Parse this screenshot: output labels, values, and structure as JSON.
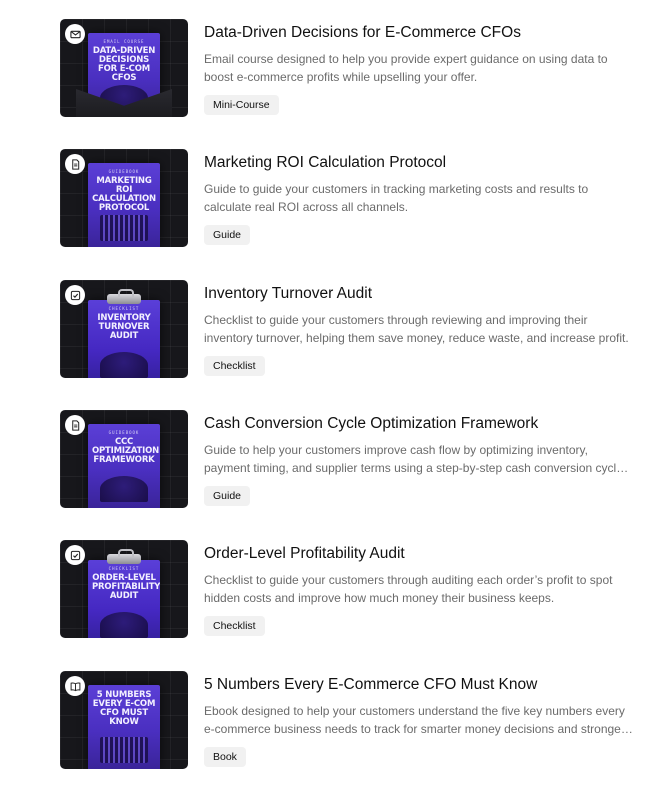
{
  "items": [
    {
      "icon": "mail-icon",
      "cover_kicker": "EMAIL COURSE",
      "cover_title": "DATA-DRIVEN DECISIONS FOR E-COM CFOS",
      "title": "Data-Driven Decisions for E-Commerce CFOs",
      "description": "Email course designed to help you provide expert guidance on using data to boost e-commerce profits while upselling your offer.",
      "tag": "Mini-Course"
    },
    {
      "icon": "document-icon",
      "cover_kicker": "GUIDEBOOK",
      "cover_title": "MARKETING ROI CALCULATION PROTOCOL",
      "title": "Marketing ROI Calculation Protocol",
      "description": "Guide to guide your customers in tracking marketing costs and results to calculate real ROI across all channels.",
      "tag": "Guide"
    },
    {
      "icon": "checklist-icon",
      "cover_kicker": "CHECKLIST",
      "cover_title": "INVENTORY TURNOVER AUDIT",
      "title": "Inventory Turnover Audit",
      "description": "Checklist to guide your customers through reviewing and improving their inventory turnover, helping them save money, reduce waste, and increase profit.",
      "tag": "Checklist"
    },
    {
      "icon": "document-icon",
      "cover_kicker": "GUIDEBOOK",
      "cover_title": "CCC OPTIMIZATION FRAMEWORK",
      "title": "Cash Conversion Cycle Optimization Framework",
      "description": "Guide to help your customers improve cash flow by optimizing inventory, payment timing, and supplier terms using a step-by-step cash conversion cycle framework.",
      "tag": "Guide"
    },
    {
      "icon": "checklist-icon",
      "cover_kicker": "CHECKLIST",
      "cover_title": "ORDER-LEVEL PROFITABILITY AUDIT",
      "title": "Order-Level Profitability Audit",
      "description": "Checklist to guide your customers through auditing each order’s profit to spot hidden costs and improve how much money their business keeps.",
      "tag": "Checklist"
    },
    {
      "icon": "book-icon",
      "cover_kicker": "",
      "cover_title": "5 NUMBERS EVERY E-COM CFO MUST KNOW",
      "title": "5 Numbers Every E-Commerce CFO Must Know",
      "description": "Ebook designed to help your customers understand the five key numbers every e-commerce business needs to track for smarter money decisions and stronger growth.",
      "tag": "Book"
    }
  ]
}
